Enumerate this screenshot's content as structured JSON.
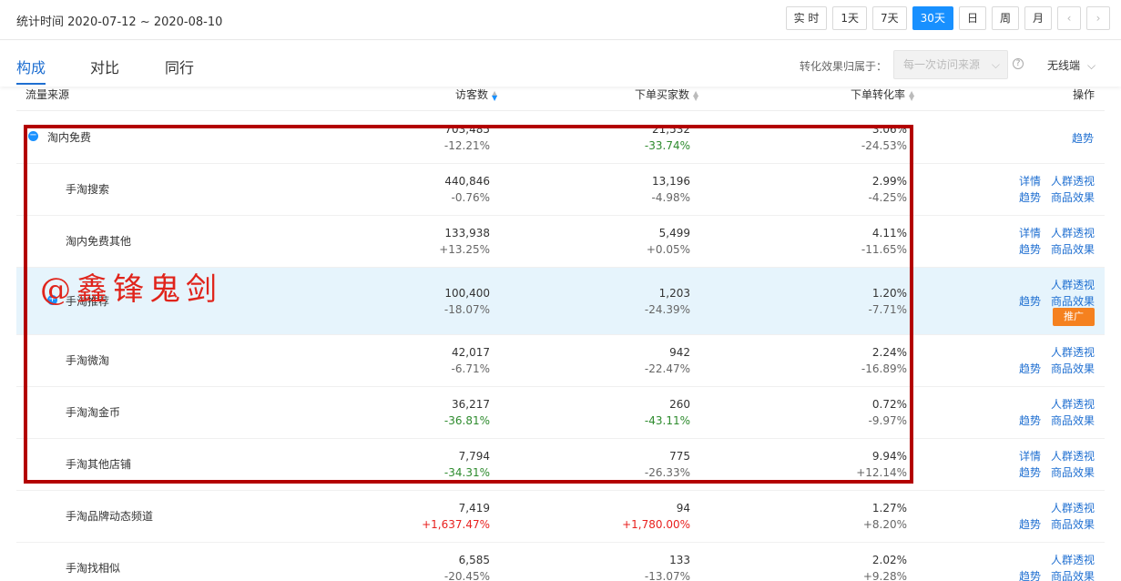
{
  "header": {
    "date_range": "统计时间 2020-07-12 ~ 2020-08-10",
    "periods": [
      "实 时",
      "1天",
      "7天",
      "30天",
      "日",
      "周",
      "月"
    ],
    "active_period": "30天",
    "prev_icon": "chevron-left-icon",
    "next_icon": "chevron-right-icon",
    "prev_glyph": "‹",
    "next_glyph": "›"
  },
  "tabs": [
    "构成",
    "对比",
    "同行"
  ],
  "attribution": {
    "label": "转化效果归属于：",
    "select_value": "每一次访问来源",
    "help_glyph": "?",
    "device": "无线端"
  },
  "table": {
    "columns": [
      "流量来源",
      "访客数",
      "下单买家数",
      "下单转化率",
      "操作"
    ],
    "rows": [
      {
        "name": "淘内免费",
        "visitors": "703,485",
        "visitors_chg": "-12.21%",
        "buyers": "21,532",
        "buyers_chg": "-33.74%",
        "rate": "3.06%",
        "rate_chg": "-24.53%",
        "ops": [
          "趋势"
        ]
      },
      {
        "name": "手淘搜索",
        "visitors": "440,846",
        "visitors_chg": "-0.76%",
        "buyers": "13,196",
        "buyers_chg": "-4.98%",
        "rate": "2.99%",
        "rate_chg": "-4.25%",
        "ops": [
          "详情",
          "人群透视",
          "趋势",
          "商品效果"
        ]
      },
      {
        "name": "淘内免费其他",
        "visitors": "133,938",
        "visitors_chg": "+13.25%",
        "buyers": "5,499",
        "buyers_chg": "+0.05%",
        "rate": "4.11%",
        "rate_chg": "-11.65%",
        "ops": [
          "详情",
          "人群透视",
          "趋势",
          "商品效果"
        ]
      },
      {
        "name": "手淘推荐",
        "visitors": "100,400",
        "visitors_chg": "-18.07%",
        "buyers": "1,203",
        "buyers_chg": "-24.39%",
        "rate": "1.20%",
        "rate_chg": "-7.71%",
        "ops": [
          "人群透视",
          "趋势",
          "商品效果",
          "推广"
        ]
      },
      {
        "name": "手淘微淘",
        "visitors": "42,017",
        "visitors_chg": "-6.71%",
        "buyers": "942",
        "buyers_chg": "-22.47%",
        "rate": "2.24%",
        "rate_chg": "-16.89%",
        "ops": [
          "人群透视",
          "趋势",
          "商品效果"
        ]
      },
      {
        "name": "手淘淘金币",
        "visitors": "36,217",
        "visitors_chg": "-36.81%",
        "buyers": "260",
        "buyers_chg": "-43.11%",
        "rate": "0.72%",
        "rate_chg": "-9.97%",
        "ops": [
          "人群透视",
          "趋势",
          "商品效果"
        ]
      },
      {
        "name": "手淘其他店铺",
        "visitors": "7,794",
        "visitors_chg": "-34.31%",
        "buyers": "775",
        "buyers_chg": "-26.33%",
        "rate": "9.94%",
        "rate_chg": "+12.14%",
        "ops": [
          "详情",
          "人群透视",
          "趋势",
          "商品效果"
        ]
      },
      {
        "name": "手淘品牌动态频道",
        "visitors": "7,419",
        "visitors_chg": "+1,637.47%",
        "buyers": "94",
        "buyers_chg": "+1,780.00%",
        "rate": "1.27%",
        "rate_chg": "+8.20%",
        "ops": [
          "人群透视",
          "趋势",
          "商品效果"
        ]
      },
      {
        "name": "手淘找相似",
        "visitors": "6,585",
        "visitors_chg": "-20.45%",
        "buyers": "133",
        "buyers_chg": "-13.07%",
        "rate": "2.02%",
        "rate_chg": "+9.28%",
        "ops": [
          "人群透视",
          "趋势",
          "商品效果"
        ]
      }
    ]
  },
  "watermark": "@鑫锋鬼剑",
  "colors": {
    "accent": "#1890ff",
    "highlight_box": "#b30000",
    "promo": "#f5811f",
    "up": "#e8211f",
    "down": "#2e8b2e"
  }
}
